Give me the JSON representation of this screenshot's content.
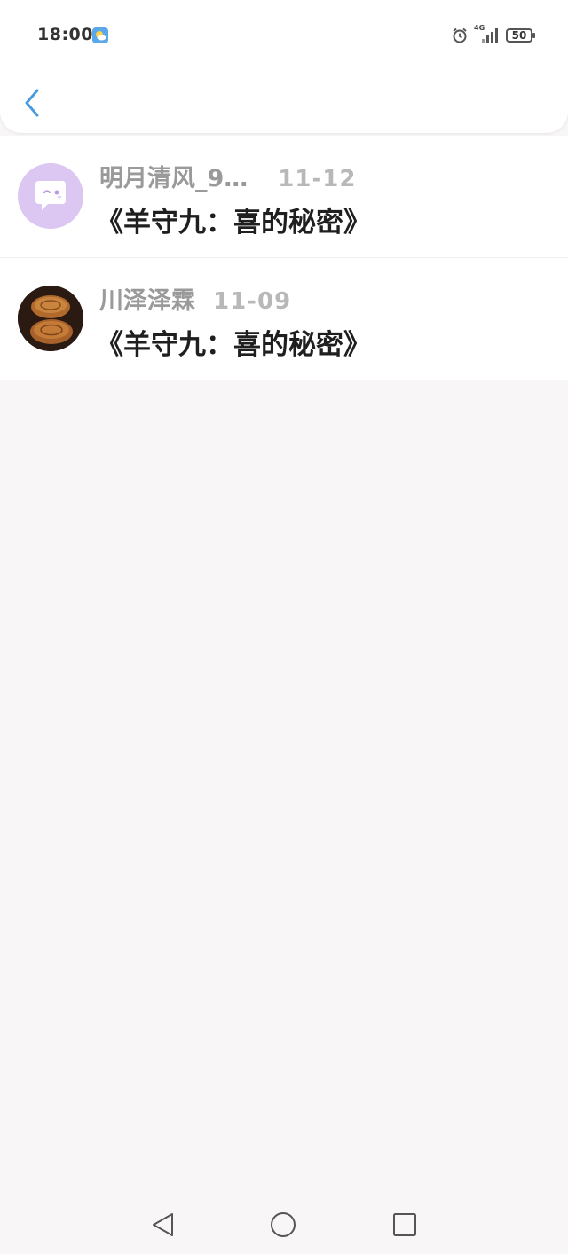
{
  "status_bar": {
    "time": "18:00",
    "network_label": "4G",
    "battery_level": "50",
    "icons": [
      "weather-icon",
      "alarm-icon",
      "signal-icon",
      "battery-icon"
    ]
  },
  "header": {
    "back_icon": "chevron-left-icon"
  },
  "list": {
    "items": [
      {
        "username": "明月清风_9…",
        "date": "11-12",
        "title": "《羊守九：喜的秘密》",
        "avatar": "chat-bubble-avatar"
      },
      {
        "username": "川泽泽霖",
        "date": "11-09",
        "title": "《羊守九：喜的秘密》",
        "avatar": "mooncake-photo-avatar"
      }
    ]
  },
  "navigation_bar": {
    "buttons": [
      "back-triangle-icon",
      "home-circle-icon",
      "recents-square-icon"
    ]
  },
  "colors": {
    "accent": "#4a9be0",
    "background": "#f8f6f7",
    "avatar_purple": "#dcc6f2",
    "title_text": "#1f1f1f",
    "meta_text": "#9a9a9a"
  }
}
